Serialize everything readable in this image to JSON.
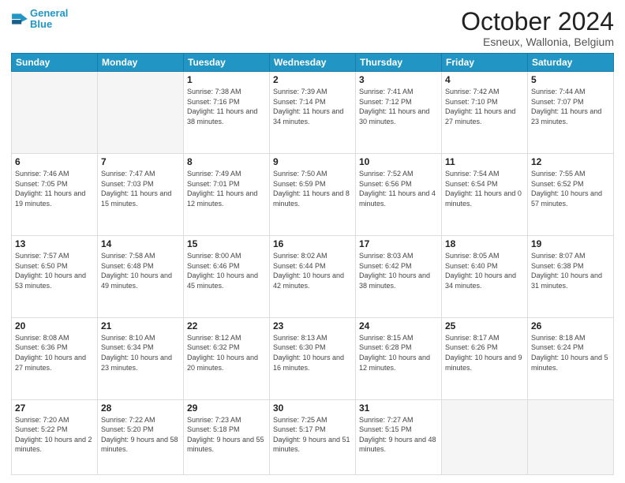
{
  "header": {
    "logo_line1": "General",
    "logo_line2": "Blue",
    "month": "October 2024",
    "location": "Esneux, Wallonia, Belgium"
  },
  "weekdays": [
    "Sunday",
    "Monday",
    "Tuesday",
    "Wednesday",
    "Thursday",
    "Friday",
    "Saturday"
  ],
  "weeks": [
    [
      {
        "day": "",
        "sunrise": "",
        "sunset": "",
        "daylight": ""
      },
      {
        "day": "",
        "sunrise": "",
        "sunset": "",
        "daylight": ""
      },
      {
        "day": "1",
        "sunrise": "Sunrise: 7:38 AM",
        "sunset": "Sunset: 7:16 PM",
        "daylight": "Daylight: 11 hours and 38 minutes."
      },
      {
        "day": "2",
        "sunrise": "Sunrise: 7:39 AM",
        "sunset": "Sunset: 7:14 PM",
        "daylight": "Daylight: 11 hours and 34 minutes."
      },
      {
        "day": "3",
        "sunrise": "Sunrise: 7:41 AM",
        "sunset": "Sunset: 7:12 PM",
        "daylight": "Daylight: 11 hours and 30 minutes."
      },
      {
        "day": "4",
        "sunrise": "Sunrise: 7:42 AM",
        "sunset": "Sunset: 7:10 PM",
        "daylight": "Daylight: 11 hours and 27 minutes."
      },
      {
        "day": "5",
        "sunrise": "Sunrise: 7:44 AM",
        "sunset": "Sunset: 7:07 PM",
        "daylight": "Daylight: 11 hours and 23 minutes."
      }
    ],
    [
      {
        "day": "6",
        "sunrise": "Sunrise: 7:46 AM",
        "sunset": "Sunset: 7:05 PM",
        "daylight": "Daylight: 11 hours and 19 minutes."
      },
      {
        "day": "7",
        "sunrise": "Sunrise: 7:47 AM",
        "sunset": "Sunset: 7:03 PM",
        "daylight": "Daylight: 11 hours and 15 minutes."
      },
      {
        "day": "8",
        "sunrise": "Sunrise: 7:49 AM",
        "sunset": "Sunset: 7:01 PM",
        "daylight": "Daylight: 11 hours and 12 minutes."
      },
      {
        "day": "9",
        "sunrise": "Sunrise: 7:50 AM",
        "sunset": "Sunset: 6:59 PM",
        "daylight": "Daylight: 11 hours and 8 minutes."
      },
      {
        "day": "10",
        "sunrise": "Sunrise: 7:52 AM",
        "sunset": "Sunset: 6:56 PM",
        "daylight": "Daylight: 11 hours and 4 minutes."
      },
      {
        "day": "11",
        "sunrise": "Sunrise: 7:54 AM",
        "sunset": "Sunset: 6:54 PM",
        "daylight": "Daylight: 11 hours and 0 minutes."
      },
      {
        "day": "12",
        "sunrise": "Sunrise: 7:55 AM",
        "sunset": "Sunset: 6:52 PM",
        "daylight": "Daylight: 10 hours and 57 minutes."
      }
    ],
    [
      {
        "day": "13",
        "sunrise": "Sunrise: 7:57 AM",
        "sunset": "Sunset: 6:50 PM",
        "daylight": "Daylight: 10 hours and 53 minutes."
      },
      {
        "day": "14",
        "sunrise": "Sunrise: 7:58 AM",
        "sunset": "Sunset: 6:48 PM",
        "daylight": "Daylight: 10 hours and 49 minutes."
      },
      {
        "day": "15",
        "sunrise": "Sunrise: 8:00 AM",
        "sunset": "Sunset: 6:46 PM",
        "daylight": "Daylight: 10 hours and 45 minutes."
      },
      {
        "day": "16",
        "sunrise": "Sunrise: 8:02 AM",
        "sunset": "Sunset: 6:44 PM",
        "daylight": "Daylight: 10 hours and 42 minutes."
      },
      {
        "day": "17",
        "sunrise": "Sunrise: 8:03 AM",
        "sunset": "Sunset: 6:42 PM",
        "daylight": "Daylight: 10 hours and 38 minutes."
      },
      {
        "day": "18",
        "sunrise": "Sunrise: 8:05 AM",
        "sunset": "Sunset: 6:40 PM",
        "daylight": "Daylight: 10 hours and 34 minutes."
      },
      {
        "day": "19",
        "sunrise": "Sunrise: 8:07 AM",
        "sunset": "Sunset: 6:38 PM",
        "daylight": "Daylight: 10 hours and 31 minutes."
      }
    ],
    [
      {
        "day": "20",
        "sunrise": "Sunrise: 8:08 AM",
        "sunset": "Sunset: 6:36 PM",
        "daylight": "Daylight: 10 hours and 27 minutes."
      },
      {
        "day": "21",
        "sunrise": "Sunrise: 8:10 AM",
        "sunset": "Sunset: 6:34 PM",
        "daylight": "Daylight: 10 hours and 23 minutes."
      },
      {
        "day": "22",
        "sunrise": "Sunrise: 8:12 AM",
        "sunset": "Sunset: 6:32 PM",
        "daylight": "Daylight: 10 hours and 20 minutes."
      },
      {
        "day": "23",
        "sunrise": "Sunrise: 8:13 AM",
        "sunset": "Sunset: 6:30 PM",
        "daylight": "Daylight: 10 hours and 16 minutes."
      },
      {
        "day": "24",
        "sunrise": "Sunrise: 8:15 AM",
        "sunset": "Sunset: 6:28 PM",
        "daylight": "Daylight: 10 hours and 12 minutes."
      },
      {
        "day": "25",
        "sunrise": "Sunrise: 8:17 AM",
        "sunset": "Sunset: 6:26 PM",
        "daylight": "Daylight: 10 hours and 9 minutes."
      },
      {
        "day": "26",
        "sunrise": "Sunrise: 8:18 AM",
        "sunset": "Sunset: 6:24 PM",
        "daylight": "Daylight: 10 hours and 5 minutes."
      }
    ],
    [
      {
        "day": "27",
        "sunrise": "Sunrise: 7:20 AM",
        "sunset": "Sunset: 5:22 PM",
        "daylight": "Daylight: 10 hours and 2 minutes."
      },
      {
        "day": "28",
        "sunrise": "Sunrise: 7:22 AM",
        "sunset": "Sunset: 5:20 PM",
        "daylight": "Daylight: 9 hours and 58 minutes."
      },
      {
        "day": "29",
        "sunrise": "Sunrise: 7:23 AM",
        "sunset": "Sunset: 5:18 PM",
        "daylight": "Daylight: 9 hours and 55 minutes."
      },
      {
        "day": "30",
        "sunrise": "Sunrise: 7:25 AM",
        "sunset": "Sunset: 5:17 PM",
        "daylight": "Daylight: 9 hours and 51 minutes."
      },
      {
        "day": "31",
        "sunrise": "Sunrise: 7:27 AM",
        "sunset": "Sunset: 5:15 PM",
        "daylight": "Daylight: 9 hours and 48 minutes."
      },
      {
        "day": "",
        "sunrise": "",
        "sunset": "",
        "daylight": ""
      },
      {
        "day": "",
        "sunrise": "",
        "sunset": "",
        "daylight": ""
      }
    ]
  ]
}
